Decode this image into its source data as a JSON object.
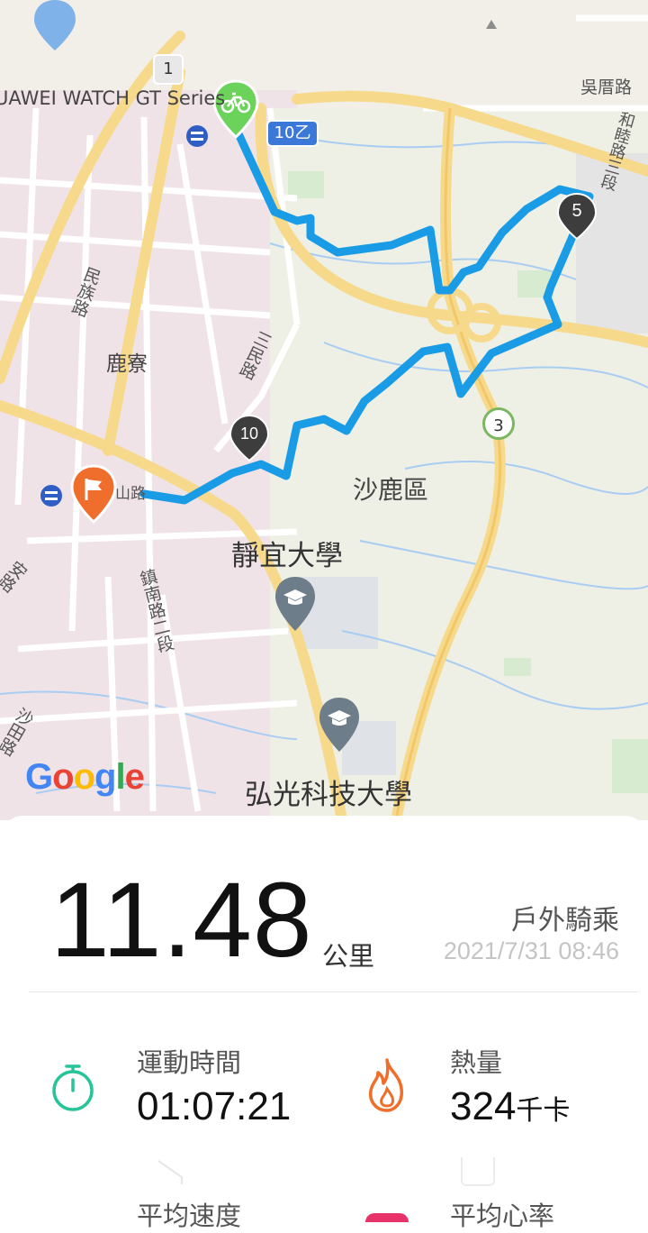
{
  "map": {
    "watch_label": "UAWEI WATCH GT Series",
    "labels": {
      "road_1": "1",
      "road_10yi": "10乙",
      "road_3": "3",
      "wuzuo_road": "吳厝路",
      "hemu_road": "和睦路三段",
      "minzu_road": "民族路",
      "lukan": "鹿寮",
      "sanmin_road": "三民路",
      "shalu_district": "沙鹿區",
      "providence_univ": "靜宜大學",
      "zhennan_road": "鎮南路二段",
      "hungkuang_univ": "弘光科技大學",
      "shatian_road": "沙田路",
      "shan_road": "山路",
      "an_road": "安路"
    },
    "km_markers": [
      "5",
      "10"
    ],
    "google_logo": [
      "G",
      "o",
      "o",
      "g",
      "l",
      "e"
    ],
    "colors": {
      "route": "#1a9be6",
      "start": "#6cd35a",
      "finish": "#f06e2b",
      "marker": "#3d3d3d"
    }
  },
  "summary": {
    "distance": "11.48",
    "distance_unit": "公里",
    "activity_type": "戶外騎乘",
    "datetime": "2021/7/31 08:46"
  },
  "stats": {
    "duration": {
      "label": "運動時間",
      "value": "01:07:21",
      "icon": "stopwatch-icon"
    },
    "calories": {
      "label": "熱量",
      "value": "324",
      "unit": "千卡",
      "icon": "flame-icon"
    },
    "avg_speed": {
      "label": "平均速度"
    },
    "avg_heart_rate": {
      "label": "平均心率"
    }
  },
  "colors": {
    "accent_green": "#27c49a",
    "accent_orange": "#f06e2b"
  }
}
